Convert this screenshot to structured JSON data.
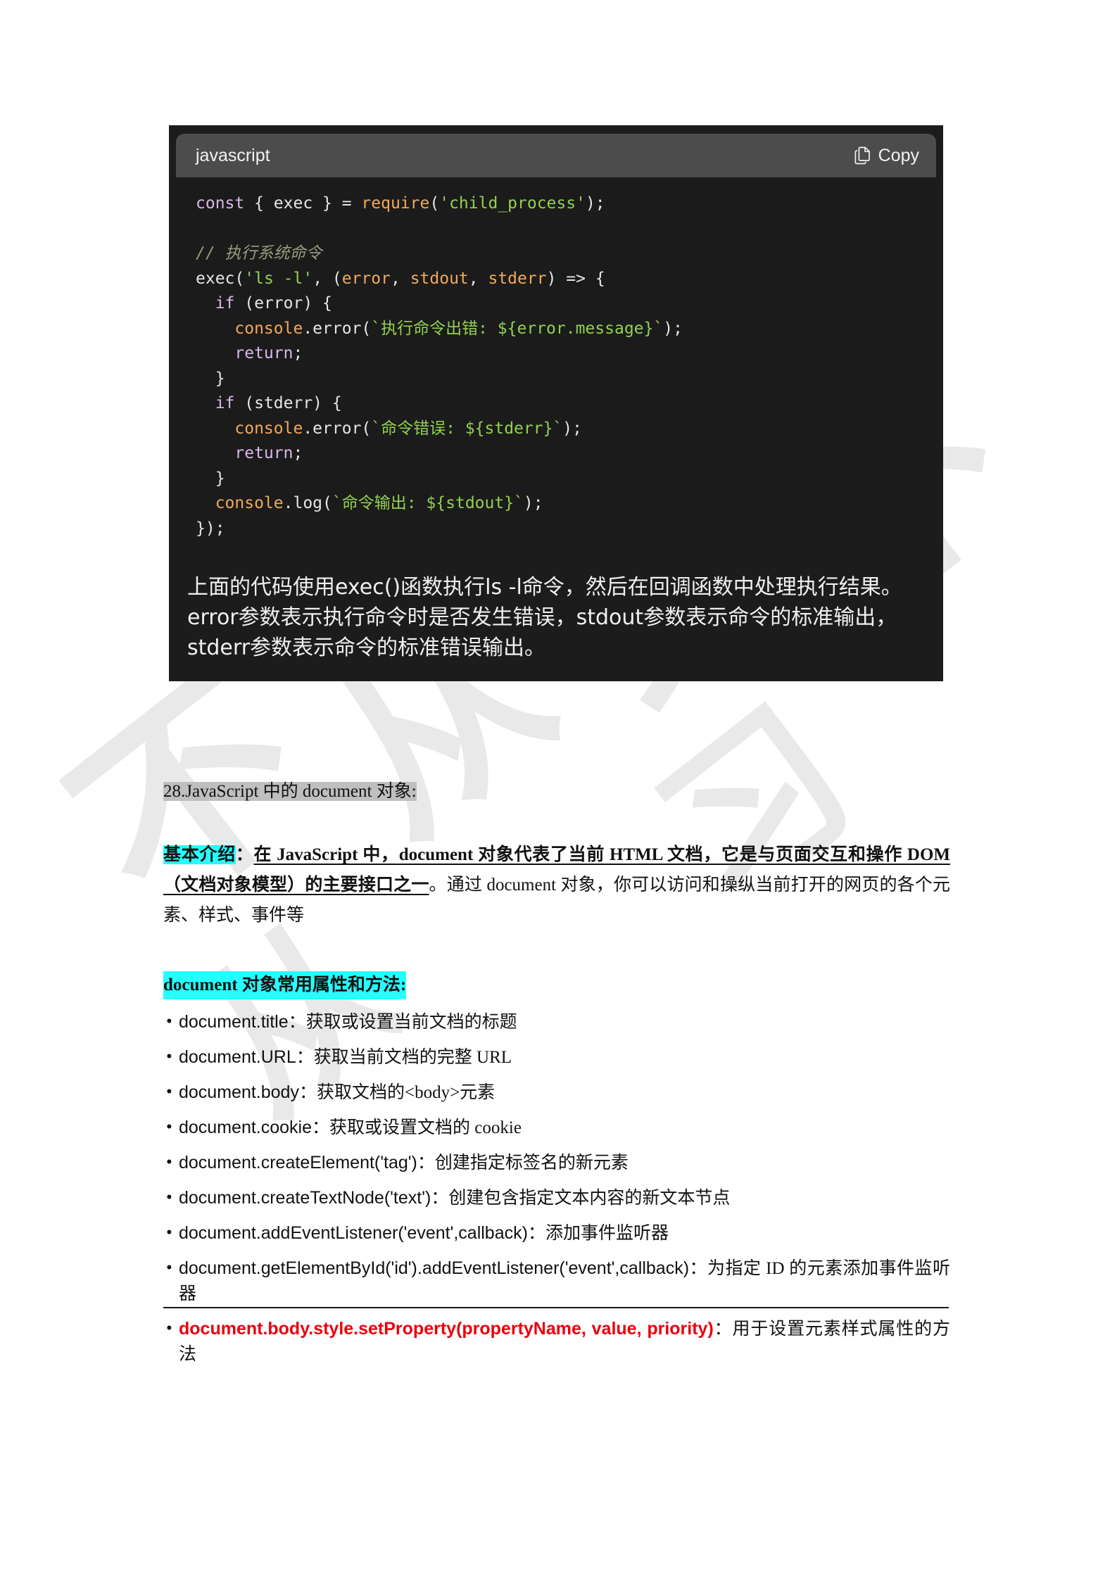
{
  "code_block": {
    "language": "javascript",
    "copy_label": "Copy",
    "copy_icon": "copy-pages-icon",
    "lines": [
      "const { exec } = require('child_process');",
      "",
      "// 执行系统命令",
      "exec('ls -l', (error, stdout, stderr) => {",
      "  if (error) {",
      "    console.error(`执行命令出错: ${error.message}`);",
      "    return;",
      "  }",
      "  if (stderr) {",
      "    console.error(`命令错误: ${stderr}`);",
      "    return;",
      "  }",
      "  console.log(`命令输出: ${stdout}`);",
      "});"
    ],
    "explanation": "上面的代码使用exec()函数执行ls -l命令，然后在回调函数中处理执行结果。error参数表示执行命令时是否发生错误，stdout参数表示命令的标准输出，stderr参数表示命令的标准错误输出。"
  },
  "section": {
    "title": "28.JavaScript 中的 document 对象:",
    "intro_label": "基本介绍",
    "intro_colon": "：",
    "intro_underlined": "在 JavaScript 中，document 对象代表了当前 HTML 文档，它是与页面交互和操作 DOM（文档对象模型）的主要接口之一",
    "intro_rest": "。通过 document 对象，你可以访问和操纵当前打开的网页的各个元素、样式、事件等",
    "list_head_bold": "document",
    "list_head_rest": " 对象常用属性和方法",
    "list_head_colon": ":",
    "methods": [
      {
        "api": "document.title",
        "sep": "：",
        "desc": "获取或设置当前文档的标题",
        "red": false
      },
      {
        "api": "document.URL",
        "sep": "：",
        "desc": "获取当前文档的完整 URL",
        "red": false
      },
      {
        "api": "document.body",
        "sep": "：",
        "desc": "获取文档的<body>元素",
        "red": false
      },
      {
        "api": "document.cookie",
        "sep": "：",
        "desc": "获取或设置文档的 cookie",
        "red": false
      },
      {
        "api": "document.createElement('tag')",
        "sep": "：",
        "desc": "创建指定标签名的新元素",
        "red": false
      },
      {
        "api": "document.createTextNode('text')",
        "sep": "：",
        "desc": "创建包含指定文本内容的新文本节点",
        "red": false
      },
      {
        "api": "document.addEventListener('event',callback)",
        "sep": "：",
        "desc": "添加事件监听器",
        "red": false
      },
      {
        "api": "document.getElementById('id').addEventListener('event',callback)",
        "sep": "：",
        "desc": "为指定 ID 的元素添加事件监听器",
        "red": false
      },
      {
        "api": "document.body.style.setProperty(propertyName, value, priority)",
        "sep": "：",
        "desc": "用于设置元素样式属性的方法",
        "red": true
      }
    ]
  },
  "watermark": {
    "glyphs": [
      "不",
      "从",
      "习",
      "不",
      "从",
      "习"
    ]
  },
  "colors": {
    "highlight_gray": "#bfbfbf",
    "highlight_cyan": "#25ffff",
    "red_text": "#e8000d",
    "code_bg": "#1b1b1b",
    "code_header_bg": "#4c4c4c",
    "keyword": "#d7b8e8",
    "function": "#f0a95c",
    "string": "#92d14f",
    "comment": "#9a9a80"
  }
}
